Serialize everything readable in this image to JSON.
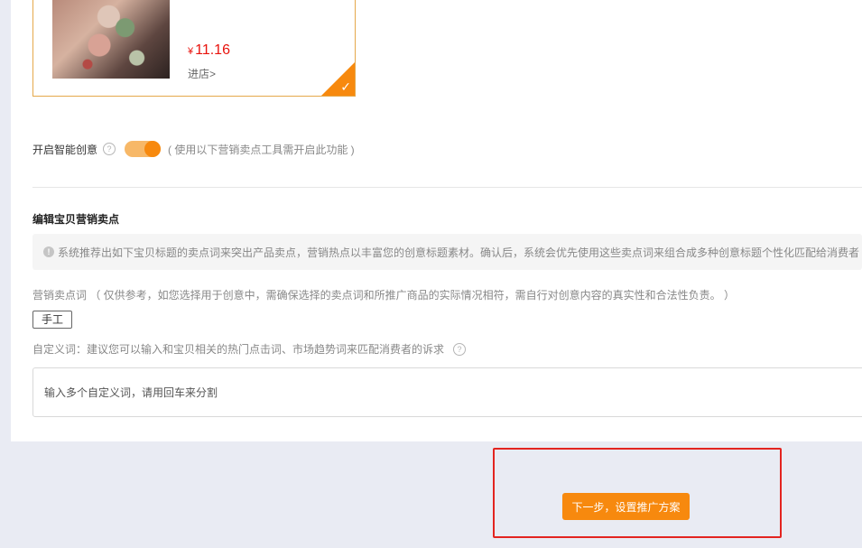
{
  "product": {
    "currency": "¥",
    "price": "11.16",
    "shop_link": "进店>",
    "selected": true
  },
  "smart_creative": {
    "label": "开启智能创意",
    "enabled": true,
    "hint": "( 使用以下营销卖点工具需开启此功能 )"
  },
  "selling_points": {
    "title": "编辑宝贝营销卖点",
    "notice": "系统推荐出如下宝贝标题的卖点词来突出产品卖点，营销热点以丰富您的创意标题素材。确认后，系统会优先使用这些卖点词来组合成多种创意标题个性化匹配给消费者",
    "words_label": "营销卖点词 （ 仅供参考，如您选择用于创意中，需确保选择的卖点词和所推广商品的实际情况相符，需自行对创意内容的真实性和合法性负责。 ）",
    "tag": "手工",
    "custom_label": "自定义词：建议您可以输入和宝贝相关的热门点击词、市场趋势词来匹配消费者的诉求",
    "custom_placeholder": "输入多个自定义词，请用回车来分割"
  },
  "footer": {
    "next_button": "下一步，设置推广方案"
  },
  "colors": {
    "accent": "#f7890e",
    "price": "#e8120c",
    "highlight_border": "#e32420"
  }
}
